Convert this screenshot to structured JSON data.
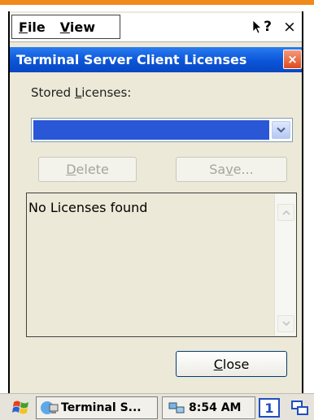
{
  "menubar": {
    "file_prefix": "",
    "file_key": "F",
    "file_rest": "ile",
    "view_key": "V",
    "view_rest": "iew",
    "help_label": "?",
    "close_label": "×"
  },
  "dialog": {
    "title": "Terminal Server Client Licenses",
    "close_label": "×",
    "stored_label_pre": "Stored ",
    "stored_label_key": "L",
    "stored_label_post": "icenses:",
    "selected_license": "",
    "delete_key": "D",
    "delete_rest": "elete",
    "save_pre": "Sa",
    "save_key": "v",
    "save_rest": "e...",
    "list_empty_text": "No Licenses found",
    "close_key": "C",
    "close_rest": "lose"
  },
  "taskbar": {
    "task_label": "Terminal S...",
    "clock": "8:54 AM",
    "desktop_number": "1"
  },
  "colors": {
    "accent_rule": "#f08a1c",
    "title_bar": "#0b55d8",
    "selection": "#2a57d6",
    "close_button": "#e04a20"
  },
  "icons": [
    "help-pointer-icon",
    "close-icon",
    "dropdown-arrow-icon",
    "scroll-up-icon",
    "scroll-down-icon",
    "start-flag-icon",
    "terminal-server-icon",
    "network-icon",
    "tray-window-icon"
  ]
}
